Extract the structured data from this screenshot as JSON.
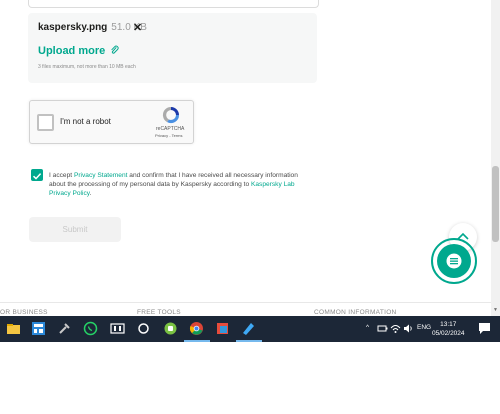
{
  "upload": {
    "file_name": "kaspersky.png",
    "file_size": "51.0 KB",
    "remove_glyph": "✕",
    "upload_more": "Upload more",
    "hint": "3 files maximum, not more than 10 MB each"
  },
  "captcha": {
    "label": "I'm not a robot",
    "brand": "reCAPTCHA",
    "links": "Privacy - Terms"
  },
  "consent": {
    "checked": true,
    "text1": "I accept ",
    "link1": "Privacy Statement",
    "text2": " and confirm that I have received all necessary information about the processing of my personal data by Kaspersky according to ",
    "link2": "Kaspersky Lab Privacy Policy",
    "text3": "."
  },
  "submit_label": "Submit",
  "footer": {
    "col1": "OR BUSINESS",
    "col2": "FREE TOOLS",
    "col3": "COMMON INFORMATION"
  },
  "taskbar": {
    "lang": "ENG",
    "time": "13:17",
    "date": "05/02/2024"
  },
  "colors": {
    "accent": "#00a88e",
    "taskbar": "#1c2737"
  }
}
